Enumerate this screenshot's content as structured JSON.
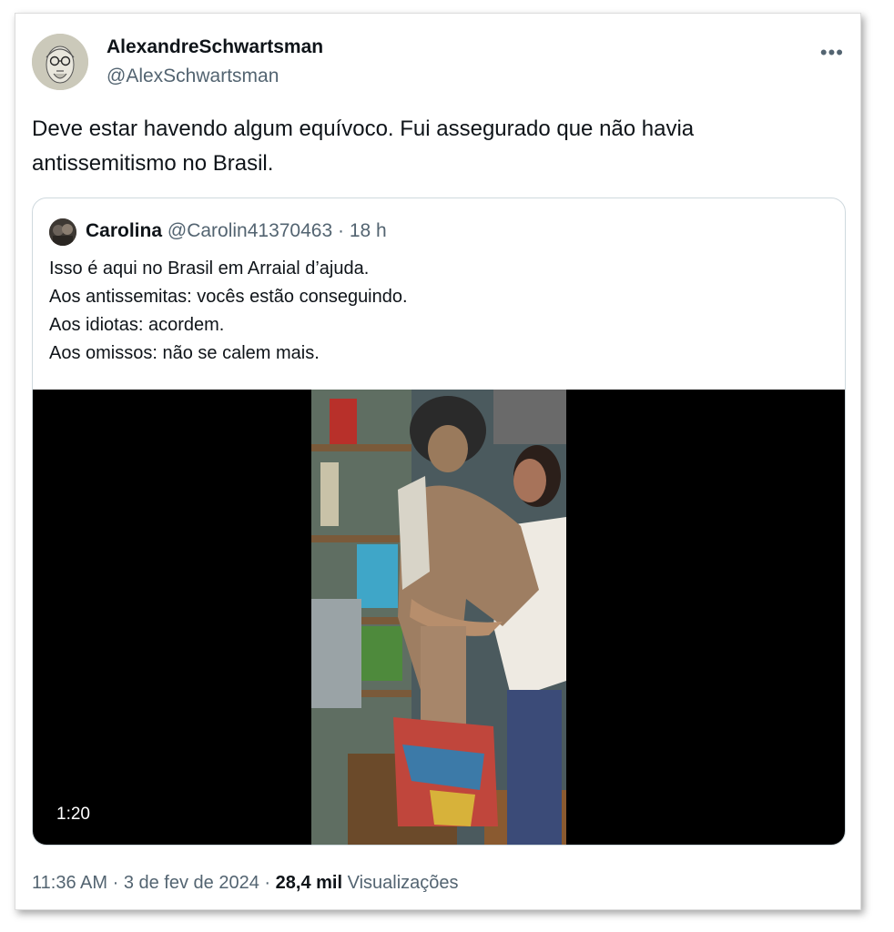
{
  "author": {
    "display_name": "AlexandreSchwartsman",
    "handle": "@AlexSchwartsman"
  },
  "more_icon": "more-horizontal-icon",
  "tweet": {
    "text": "Deve estar havendo algum equívoco. Fui assegurado que não havia antissemitismo no Brasil."
  },
  "quote": {
    "name": "Carolina",
    "handle": "@Carolin41370463",
    "time": "· 18 h",
    "lines": [
      "Isso é aqui no Brasil em Arraial d’ajuda.",
      "Aos antissemitas: vocês estão conseguindo.",
      "Aos idiotas: acordem.",
      "Aos omissos: não se calem mais."
    ],
    "video": {
      "duration": "1:20"
    }
  },
  "footer": {
    "time": "11:36 AM",
    "sep1": "·",
    "date": "3 de fev de 2024",
    "sep2": "·",
    "views_count": "28,4 mil",
    "views_label": "Visualizações"
  }
}
